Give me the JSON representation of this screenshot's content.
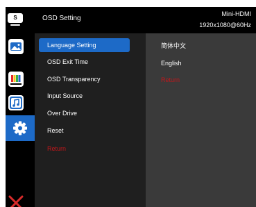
{
  "header": {
    "brand_icon_char": "S",
    "title": "OSD Setting",
    "source": "Mini-HDMI",
    "resolution": "1920x1080@60Hz"
  },
  "sidebar": {
    "items": [
      {
        "icon": "image-icon"
      },
      {
        "icon": "color-bars-icon"
      },
      {
        "icon": "music-note-icon"
      },
      {
        "icon": "gear-icon",
        "active": true
      },
      {
        "icon": "close-icon"
      }
    ]
  },
  "menu": {
    "items": [
      {
        "label": "Language Setting",
        "selected": true
      },
      {
        "label": "OSD Exit Time"
      },
      {
        "label": "OSD Transparency"
      },
      {
        "label": "Input Source"
      },
      {
        "label": "Over Drive"
      },
      {
        "label": "Reset"
      },
      {
        "label": "Return"
      }
    ]
  },
  "values": {
    "items": [
      {
        "label": "简体中文"
      },
      {
        "label": "English"
      },
      {
        "label": "Return"
      }
    ]
  },
  "colors": {
    "accent": "#1d6ac7",
    "return_red": "#c0171b",
    "close_red": "#d92b2b"
  }
}
